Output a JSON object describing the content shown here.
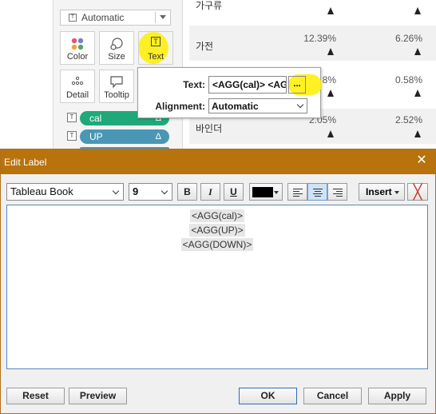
{
  "marks": {
    "mark_type": "Automatic",
    "buttons": {
      "color": "Color",
      "size": "Size",
      "text": "Text",
      "detail": "Detail",
      "tooltip": "Tooltip"
    },
    "pills": [
      {
        "label": "cal",
        "color": "#1fa97a"
      },
      {
        "label": "UP",
        "color": "#4a97b5"
      }
    ]
  },
  "table": {
    "rows": [
      {
        "label": "가구류",
        "v1": "",
        "v2": ""
      },
      {
        "label": "가전",
        "v1": "12.39%",
        "v2": "6.26%"
      },
      {
        "label": "",
        "v1": "8%",
        "v2": "0.58%"
      },
      {
        "label": "바인더",
        "v1": "2.05%",
        "v2": "2.52%"
      }
    ]
  },
  "text_popover": {
    "text_label": "Text:",
    "text_value": "<AGG(cal)> <AGG(UP)>",
    "dots_label": "...",
    "alignment_label": "Alignment:",
    "alignment_value": "Automatic"
  },
  "dialog": {
    "title": "Edit Label",
    "close_glyph": "✕",
    "font_family": "Tableau Book",
    "font_size": "9",
    "bold_label": "B",
    "italic_label": "I",
    "underline_label": "U",
    "text_color": "#000000",
    "insert_label": "Insert",
    "clear_glyph": "╳",
    "editor_lines": [
      "<AGG(cal)>",
      "<AGG(UP)>",
      "<AGG(DOWN)>"
    ],
    "buttons": {
      "reset": "Reset",
      "preview": "Preview",
      "ok": "OK",
      "cancel": "Cancel",
      "apply": "Apply"
    }
  },
  "colors": {
    "title_bar": "#b8730d",
    "highlight": "#ffee00"
  }
}
